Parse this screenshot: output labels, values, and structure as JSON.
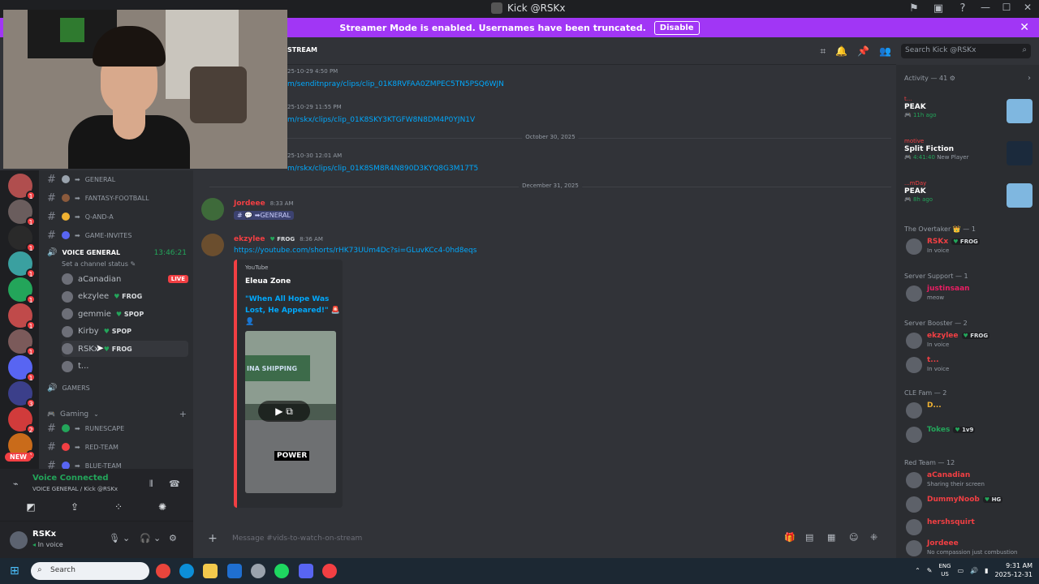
{
  "window": {
    "title": "Kick @RSKx"
  },
  "banner": {
    "text": "Streamer Mode is enabled. Usernames have been truncated.",
    "disable_label": "Disable"
  },
  "servers": {
    "new_label": "NEW",
    "badges": [
      "1",
      "1",
      "1",
      "1",
      "1",
      "1",
      "1",
      "1",
      "3",
      "2",
      "1",
      "1"
    ]
  },
  "channels": {
    "text": [
      {
        "emoji_color": "#9aa3ad",
        "name": "GENERAL"
      },
      {
        "emoji_color": "#8b5a3c",
        "name": "FANTASY-FOOTBALL"
      },
      {
        "emoji_color": "#f0b232",
        "name": "Q-AND-A"
      },
      {
        "emoji_color": "#5865f2",
        "name": "GAME-INVITES"
      }
    ],
    "voice_channel": {
      "name": "VOICE GENERAL",
      "timer": "13:46:21",
      "status": "Set a channel status"
    },
    "voice_users": [
      {
        "name": "aCanadian",
        "tag_name": "",
        "badge": "LIVE"
      },
      {
        "name": "ekzylee",
        "tag_name": "FROG",
        "badge": ""
      },
      {
        "name": "gemmie",
        "tag_name": "SPOP",
        "badge": ""
      },
      {
        "name": "Kirby",
        "tag_name": "SPOP",
        "badge": ""
      },
      {
        "name": "RSKx",
        "tag_name": "FROG",
        "badge": ""
      },
      {
        "name": "t...",
        "tag_name": "",
        "badge": ""
      }
    ],
    "gamers_label": "GAMERS",
    "gaming_category": "Gaming",
    "gaming_channels": [
      {
        "emoji_color": "#23a55a",
        "name": "RUNESCAPE"
      },
      {
        "emoji_color": "#f23f43",
        "name": "RED-TEAM"
      },
      {
        "emoji_color": "#5865f2",
        "name": "BLUE-TEAM"
      }
    ]
  },
  "voice_panel": {
    "title": "Voice Connected",
    "subtitle": "VOICE GENERAL / Kick @RSKx"
  },
  "user_panel": {
    "name": "RSKx",
    "status": "In voice"
  },
  "chat": {
    "channel_name": "STREAM",
    "composer_placeholder": "Message #vids-to-watch-on-stream",
    "search_placeholder": "Search Kick @RSKx",
    "history": [
      {
        "stamp": "25-10-29 4:50 PM",
        "link": "m/senditnpray/clips/clip_01K8RVFAA0ZMPEC5TN5PSQ6WJN"
      },
      {
        "stamp": "25-10-29 11:55 PM",
        "link": "m/rskx/clips/clip_01K8SKY3KTGFW8N8DM4P0YJN1V"
      },
      {
        "stamp": "25-10-30 12:01 AM",
        "link": "m/rskx/clips/clip_01K8SM8R4N890D3KYQ8G3M17T5"
      }
    ],
    "dividers": [
      "October 30, 2025",
      "December 31, 2025"
    ],
    "messages": [
      {
        "author": "Jordeee",
        "time": "8:33 AM",
        "mention": "# 💬 ➡GENERAL"
      },
      {
        "author": "ekzylee",
        "tag_name": "FROG",
        "time": "8:36 AM",
        "link": "https://youtube.com/shorts/rHK73UUm4Dc?si=GLuvKCc4-0hd8eqs"
      }
    ],
    "embed": {
      "provider": "YouTube",
      "author": "Eleua Zone",
      "title": "\"When All Hope Was Lost, He Appeared!\" 🚨👤",
      "thumb_sign": "INA SHIPPING",
      "thumb_caption": "POWER"
    }
  },
  "members": {
    "activity_header": "Activity — 41 ⚙",
    "activities": [
      {
        "who": "t...",
        "game": "PEAK",
        "meta": "11h ago",
        "meta_extra": "",
        "art_color": "#7fb7e0"
      },
      {
        "who": "motive",
        "game": "Split Fiction",
        "meta": "4:41:40",
        "meta_extra": "New Player",
        "art_color": "#1b2a3c"
      },
      {
        "who": "...mDay",
        "game": "PEAK",
        "meta": "8h ago",
        "meta_extra": "",
        "art_color": "#7fb7e0"
      }
    ],
    "groups": [
      {
        "label": "The Overtaker 👑 — 1"
      },
      {
        "label": "Server Support — 1"
      },
      {
        "label": "Server Booster — 2"
      },
      {
        "label": "CLE Fam — 2"
      },
      {
        "label": "Red Team — 12"
      }
    ],
    "list": [
      {
        "name": "RSKx",
        "tag_name": "FROG",
        "sub": "In voice",
        "color": "#f23f43"
      },
      {
        "name": "justinsaan",
        "tag_name": "",
        "sub": "meow",
        "color": "#e91e63"
      },
      {
        "name": "ekzylee",
        "tag_name": "FROG",
        "sub": "In voice",
        "color": "#f23f43"
      },
      {
        "name": "t...",
        "tag_name": "",
        "sub": "In voice",
        "color": "#f23f43"
      },
      {
        "name": "D...",
        "tag_name": "",
        "sub": "",
        "color": "#f0b232"
      },
      {
        "name": "Tokes",
        "tag_name": "1v9",
        "sub": "",
        "color": "#23a55a"
      },
      {
        "name": "aCanadian",
        "tag_name": "",
        "sub": "Sharing their screen",
        "color": "#f23f43"
      },
      {
        "name": "DummyNoob",
        "tag_name": "HG",
        "sub": "",
        "color": "#f23f43"
      },
      {
        "name": "hershsquirt",
        "tag_name": "",
        "sub": "",
        "color": "#f23f43"
      },
      {
        "name": "Jordeee",
        "tag_name": "",
        "sub": "No compassion just combustion",
        "color": "#f23f43"
      }
    ]
  },
  "taskbar": {
    "search_label": "Search",
    "lang": "ENG",
    "region": "US",
    "time": "9:31 AM",
    "date": "2025-12-31"
  }
}
